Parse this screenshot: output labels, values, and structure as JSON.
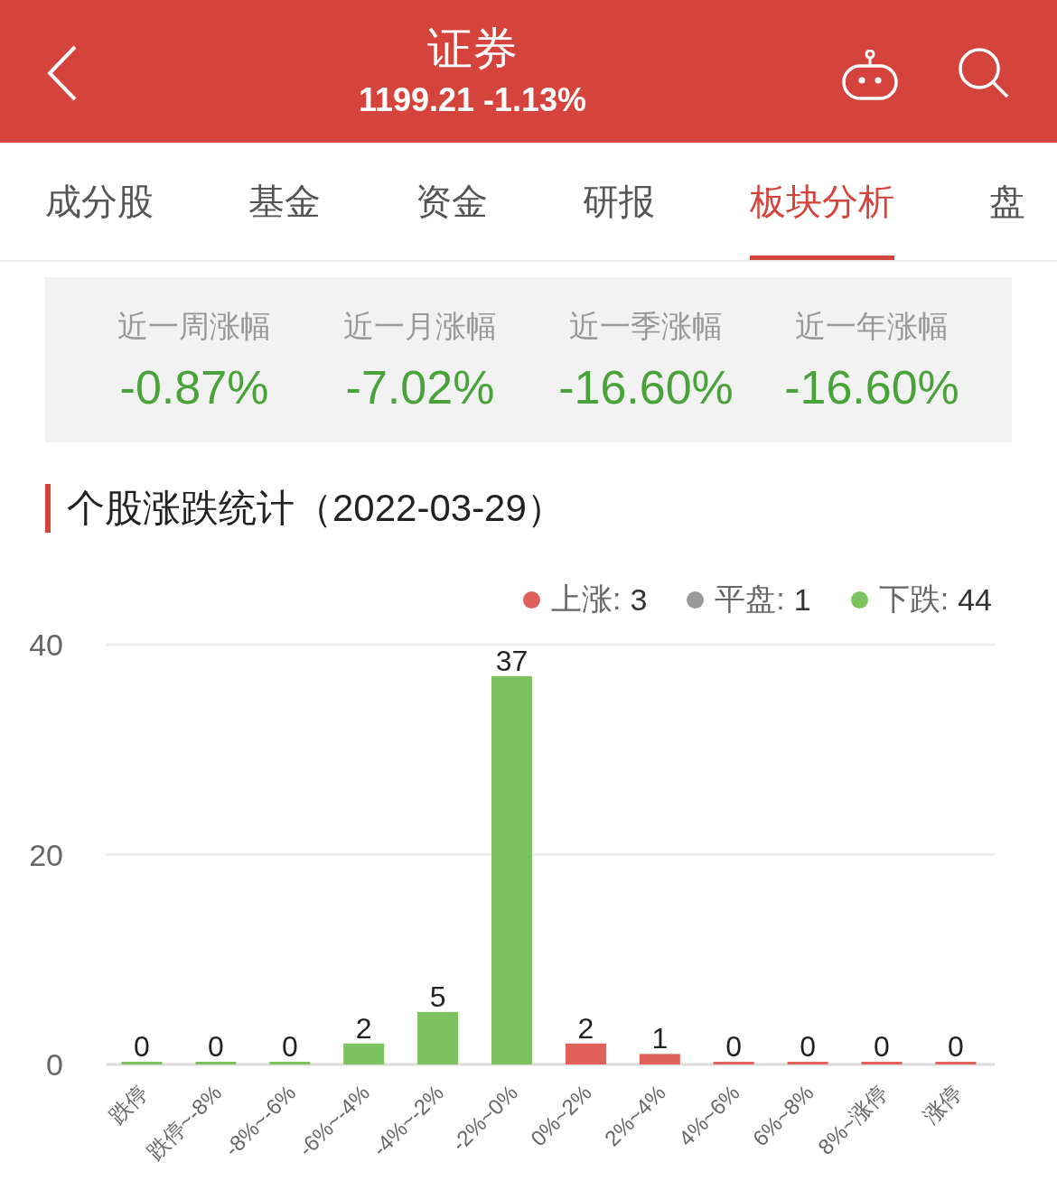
{
  "header": {
    "title": "证券",
    "quote": "1199.21 -1.13%"
  },
  "tabs": [
    {
      "label": "成分股",
      "selected": false
    },
    {
      "label": "基金",
      "selected": false
    },
    {
      "label": "资金",
      "selected": false
    },
    {
      "label": "研报",
      "selected": false
    },
    {
      "label": "板块分析",
      "selected": true
    },
    {
      "label": "盘",
      "selected": false
    }
  ],
  "stats": [
    {
      "label": "近一周涨幅",
      "value": "-0.87%"
    },
    {
      "label": "近一月涨幅",
      "value": "-7.02%"
    },
    {
      "label": "近一季涨幅",
      "value": "-16.60%"
    },
    {
      "label": "近一年涨幅",
      "value": "-16.60%"
    }
  ],
  "section_title": "个股涨跌统计（2022-03-29）",
  "legend": [
    {
      "label": "上涨:",
      "count": "3",
      "color": "#e0605a"
    },
    {
      "label": "平盘:",
      "count": "1",
      "color": "#9a9a9a"
    },
    {
      "label": "下跌:",
      "count": "44",
      "color": "#7cc35f"
    }
  ],
  "chart_data": {
    "type": "bar",
    "stacked": true,
    "data_labels": true,
    "ylim": [
      0,
      40
    ],
    "yticks": [
      0,
      20,
      40
    ],
    "categories": [
      "跌停",
      "跌停~-8%",
      "-8%~-6%",
      "-6%~-4%",
      "-4%~-2%",
      "-2%~0%",
      "0%~2%",
      "2%~4%",
      "4%~6%",
      "6%~8%",
      "8%~涨停",
      "涨停"
    ],
    "series": [
      {
        "color": "#7cc35f",
        "values": [
          0,
          0,
          0,
          2,
          5,
          37,
          null,
          null,
          null,
          null,
          null,
          null
        ]
      },
      {
        "color": "#e0605a",
        "values": [
          null,
          null,
          null,
          null,
          null,
          null,
          2,
          1,
          0,
          0,
          0,
          0
        ]
      }
    ]
  }
}
